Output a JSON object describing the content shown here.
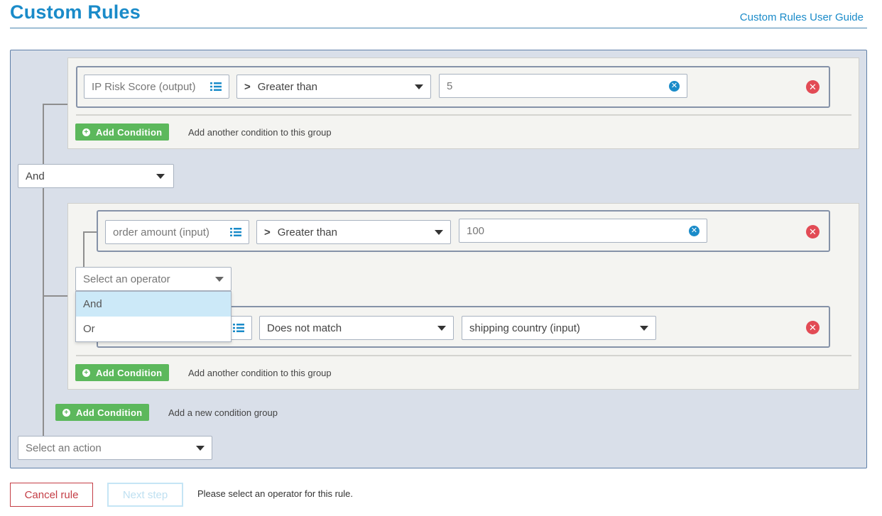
{
  "header": {
    "title": "Custom Rules",
    "guide_link": "Custom Rules User Guide"
  },
  "group1": {
    "condition": {
      "field": "IP Risk Score (output)",
      "operator_symbol": ">",
      "operator": "Greater than",
      "value": "5"
    },
    "add_button": "Add Condition",
    "add_hint": "Add another condition to this group"
  },
  "group_operator": {
    "value": "And"
  },
  "group2": {
    "condition1": {
      "field": "order amount (input)",
      "operator_symbol": ">",
      "operator": "Greater than",
      "value": "100"
    },
    "inner_operator": {
      "placeholder": "Select an operator",
      "options": [
        "And",
        "Or"
      ],
      "highlighted": "And"
    },
    "condition2": {
      "operator": "Does not match",
      "value": "shipping country (input)"
    },
    "add_button": "Add Condition",
    "add_hint": "Add another condition to this group"
  },
  "outer": {
    "add_button": "Add Condition",
    "add_hint": "Add a new condition group"
  },
  "action": {
    "placeholder": "Select an action"
  },
  "footer": {
    "cancel": "Cancel rule",
    "next": "Next step",
    "message": "Please select an operator for this rule."
  },
  "icons": {
    "field_list": "list-icon",
    "clear": "clear-icon",
    "delete": "delete-icon",
    "add": "plus-circle-icon",
    "dropdown": "chevron-down-icon"
  },
  "colors": {
    "brand": "#1a8bc9",
    "add_button": "#5cb85c",
    "delete": "#e24b55",
    "cancel": "#c43d45",
    "panel_bg": "#d9dfe9",
    "highlight": "#cce9f8"
  }
}
